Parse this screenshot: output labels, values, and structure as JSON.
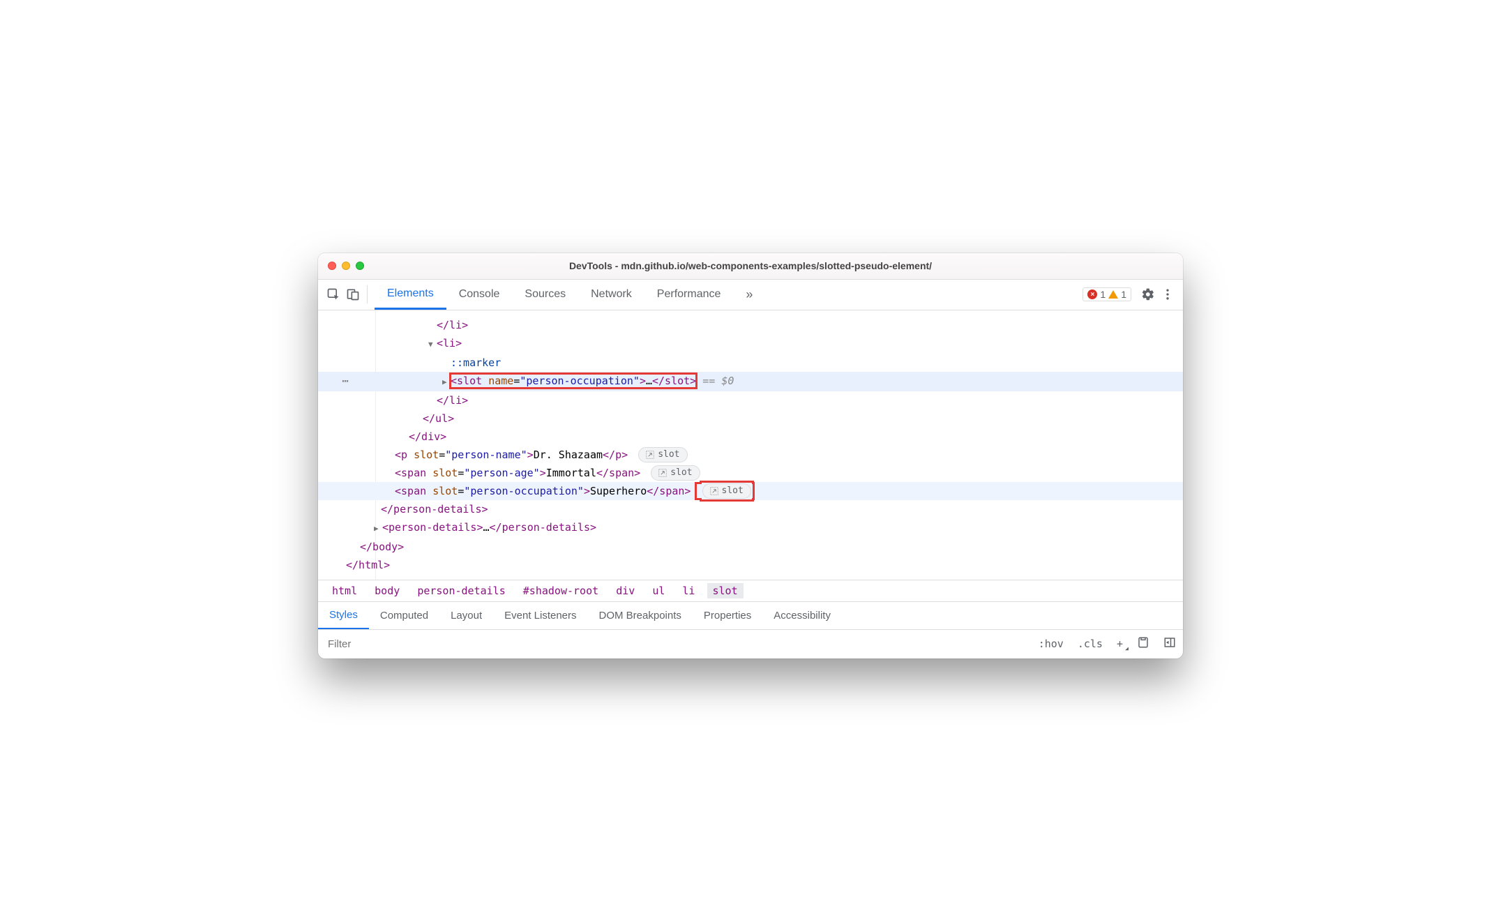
{
  "window": {
    "title": "DevTools - mdn.github.io/web-components-examples/slotted-pseudo-element/"
  },
  "tabs": {
    "t0": "Elements",
    "t1": "Console",
    "t2": "Sources",
    "t3": "Network",
    "t4": "Performance",
    "more": "»"
  },
  "issues": {
    "errors": "1",
    "warnings": "1"
  },
  "dom": {
    "li_close": "</li>",
    "li_open": "<li>",
    "marker": "::marker",
    "slot_open": "<slot ",
    "slot_attr_name": "name",
    "slot_attr_eq": "=",
    "slot_attr_val": "\"person-occupation\"",
    "slot_gt": ">",
    "slot_ell": "…",
    "slot_close": "</slot>",
    "eq0": " == $0",
    "li_close2": "</li>",
    "ul_close": "</ul>",
    "div_close": "</div>",
    "p_open": "<p ",
    "p_attr": "slot",
    "p_eq": "=",
    "p_val": "\"person-name\"",
    "p_gt": ">",
    "p_text": "Dr. Shazaam",
    "p_close": "</p>",
    "s1_open": "<span ",
    "s1_attr": "slot",
    "s1_eq": "=",
    "s1_val": "\"person-age\"",
    "s1_gt": ">",
    "s1_text": "Immortal",
    "s1_close": "</span>",
    "s2_open": "<span ",
    "s2_attr": "slot",
    "s2_eq": "=",
    "s2_val": "\"person-occupation\"",
    "s2_gt": ">",
    "s2_text": "Superhero",
    "s2_close": "</span>",
    "pd_close": "</person-details>",
    "pd2": "<person-details>",
    "pd2e": "…",
    "pd2c": "</person-details>",
    "body_close": "</body>",
    "html_close": "</html>",
    "slot_badge": "slot"
  },
  "crumbs": {
    "c0": "html",
    "c1": "body",
    "c2": "person-details",
    "c3": "#shadow-root",
    "c4": "div",
    "c5": "ul",
    "c6": "li",
    "c7": "slot"
  },
  "subtabs": {
    "s0": "Styles",
    "s1": "Computed",
    "s2": "Layout",
    "s3": "Event Listeners",
    "s4": "DOM Breakpoints",
    "s5": "Properties",
    "s6": "Accessibility"
  },
  "filter": {
    "placeholder": "Filter",
    "hov": ":hov",
    "cls": ".cls",
    "plus": "+"
  }
}
